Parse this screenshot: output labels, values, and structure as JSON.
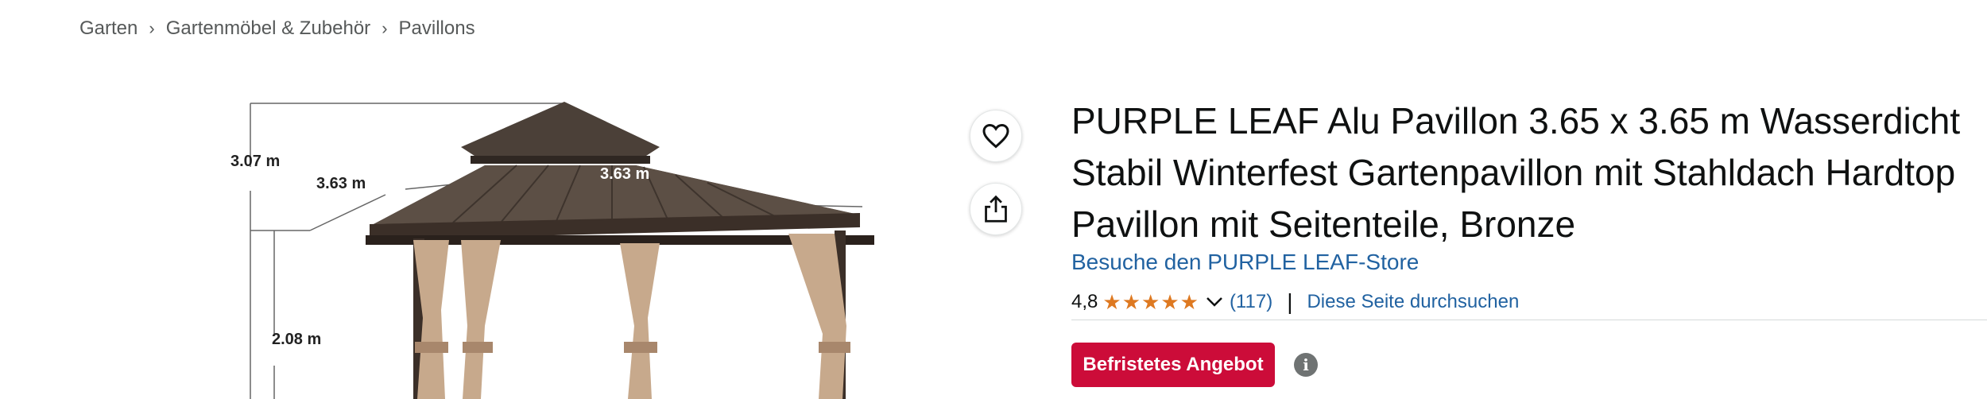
{
  "breadcrumb": {
    "items": [
      "Garten",
      "Gartenmöbel & Zubehör",
      "Pavillons"
    ],
    "separator": "›"
  },
  "product_image": {
    "dimension_labels": [
      "3.07 m",
      "3.63 m",
      "3.63 m",
      "2.08 m"
    ]
  },
  "actions": {
    "wishlist_icon": "heart-icon",
    "share_icon": "share-icon"
  },
  "product": {
    "title": "PURPLE LEAF Alu Pavillon 3.65 x 3.65 m Wasserdicht Stabil Winterfest Gartenpavillon mit Stahldach Hardtop Pavillon mit Seitenteile, Bronze",
    "store_link": "Besuche den PURPLE LEAF-Store",
    "rating": "4,8",
    "rating_stars": 4.8,
    "review_count": "(117)",
    "search_link": "Diese Seite durchsuchen",
    "deal_badge": "Befristetes Angebot"
  },
  "colors": {
    "link": "#2162a1",
    "star": "#de7921",
    "deal": "#cc0c39"
  }
}
